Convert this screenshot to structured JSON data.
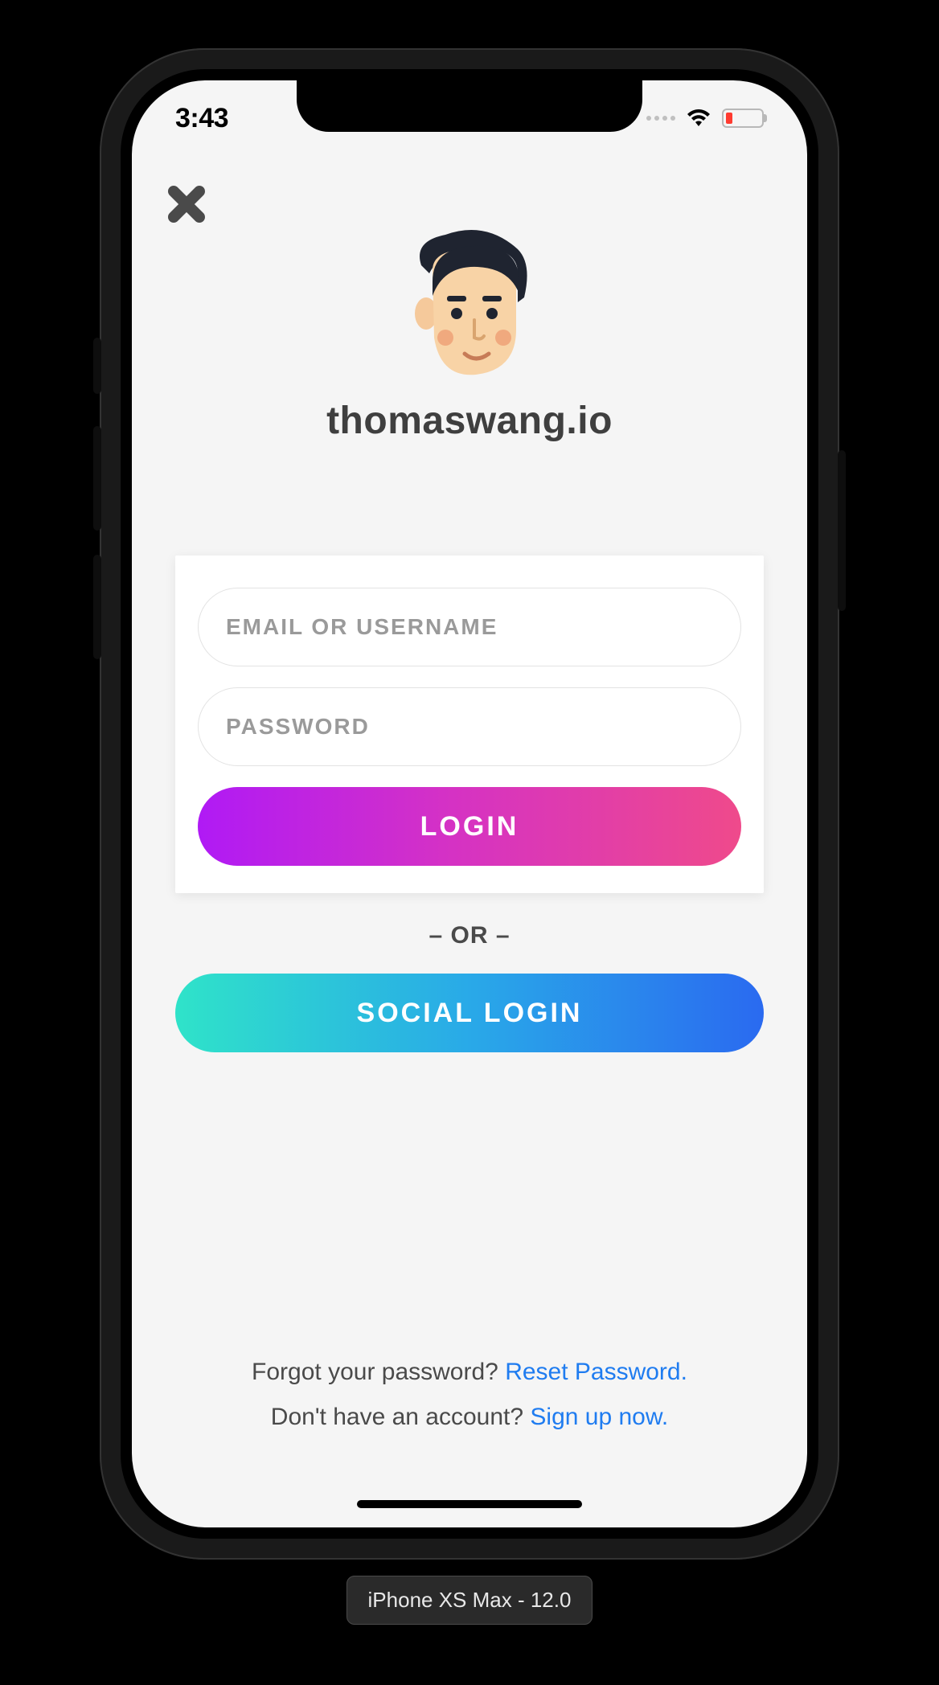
{
  "statusbar": {
    "time": "3:43"
  },
  "brand": {
    "name": "thomaswang.io"
  },
  "form": {
    "email_placeholder": "EMAIL OR USERNAME",
    "password_placeholder": "PASSWORD",
    "login_label": "LOGIN",
    "or_label": "– OR –",
    "social_label": "SOCIAL LOGIN"
  },
  "footer": {
    "forgot_prompt": "Forgot your password?  ",
    "forgot_link": "Reset Password.",
    "signup_prompt": "Don't have an account?  ",
    "signup_link": "Sign up now."
  },
  "device_label": "iPhone XS Max - 12.0"
}
